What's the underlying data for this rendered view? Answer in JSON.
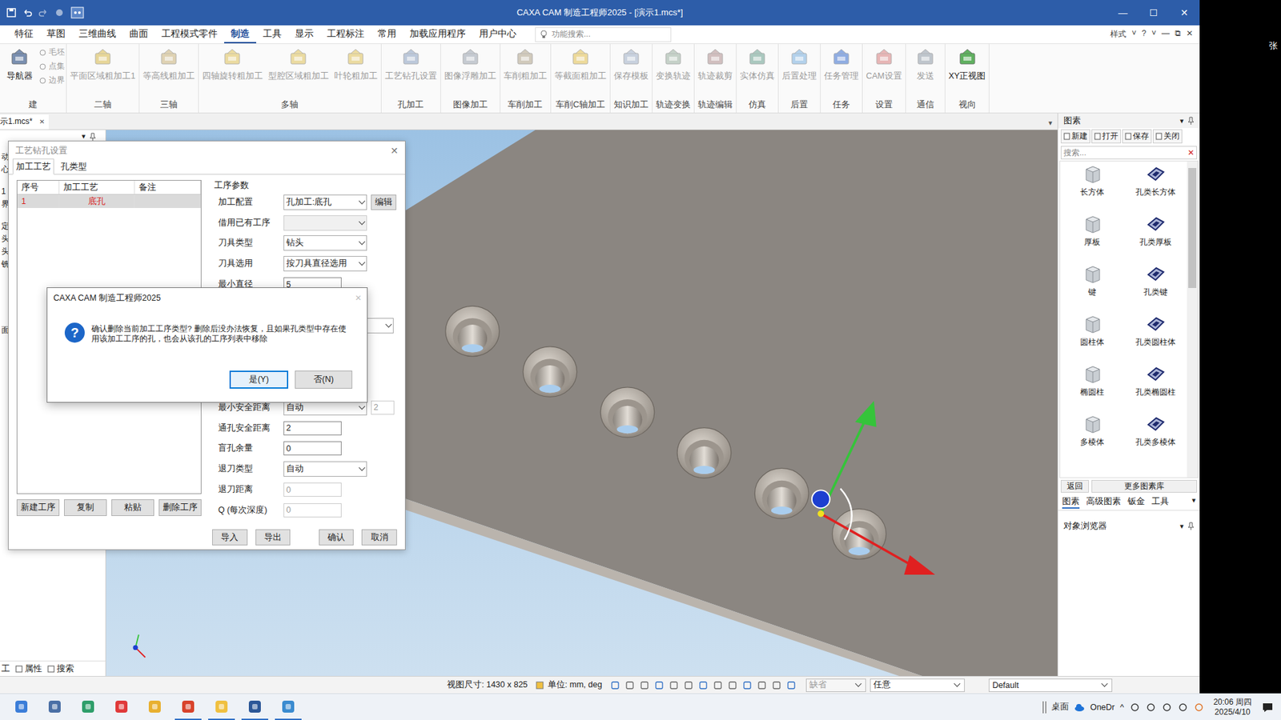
{
  "window": {
    "title": "CAXA CAM 制造工程师2025 - [演示1.mcs*]",
    "controls": [
      "—",
      "☐",
      "✕"
    ]
  },
  "outside_text": "张",
  "menu": {
    "items": [
      {
        "label": "特征",
        "selected": false
      },
      {
        "label": "草图",
        "selected": false
      },
      {
        "label": "三维曲线",
        "selected": false
      },
      {
        "label": "曲面",
        "selected": false
      },
      {
        "label": "工程模式零件",
        "selected": false
      },
      {
        "label": "制造",
        "selected": true
      },
      {
        "label": "工具",
        "selected": false
      },
      {
        "label": "显示",
        "selected": false
      },
      {
        "label": "工程标注",
        "selected": false
      },
      {
        "label": "常用",
        "selected": false
      },
      {
        "label": "加载应用程序",
        "selected": false
      },
      {
        "label": "用户中心",
        "selected": false
      }
    ],
    "search_placeholder": "功能搜索...",
    "right": [
      "样式",
      "˅",
      "?",
      "˅",
      "—",
      "⧉",
      "✕"
    ]
  },
  "ribbon": {
    "groups": [
      {
        "label": "建",
        "tools": [
          {
            "label": "导航器",
            "kind": "large",
            "disabled": false
          },
          {
            "label": "毛坯",
            "kind": "small",
            "disabled": true
          },
          {
            "label": "点集",
            "kind": "small",
            "disabled": true
          },
          {
            "label": "边界",
            "kind": "small",
            "disabled": true
          }
        ]
      },
      {
        "label": "二轴",
        "tools": [
          {
            "label": "平面区域粗加工1",
            "kind": "large",
            "disabled": true
          }
        ]
      },
      {
        "label": "三轴",
        "tools": [
          {
            "label": "等高线粗加工",
            "kind": "large",
            "disabled": true
          }
        ]
      },
      {
        "label": "多轴",
        "tools": [
          {
            "label": "四轴旋转粗加工",
            "kind": "large",
            "disabled": true
          },
          {
            "label": "型腔区域粗加工",
            "kind": "large",
            "disabled": true
          },
          {
            "label": "叶轮粗加工",
            "kind": "large",
            "disabled": true
          }
        ]
      },
      {
        "label": "孔加工",
        "tools": [
          {
            "label": "工艺钻孔设置",
            "kind": "large",
            "disabled": true
          }
        ]
      },
      {
        "label": "图像加工",
        "tools": [
          {
            "label": "图像浮雕加工",
            "kind": "large",
            "disabled": true
          }
        ]
      },
      {
        "label": "车削加工",
        "tools": [
          {
            "label": "车削粗加工",
            "kind": "large",
            "disabled": true
          }
        ]
      },
      {
        "label": "车削C轴加工",
        "tools": [
          {
            "label": "等截面粗加工",
            "kind": "large",
            "disabled": true
          }
        ]
      },
      {
        "label": "知识加工",
        "tools": [
          {
            "label": "保存模板",
            "kind": "large",
            "disabled": true
          }
        ]
      },
      {
        "label": "轨迹变换",
        "tools": [
          {
            "label": "变换轨迹",
            "kind": "large",
            "disabled": true
          }
        ]
      },
      {
        "label": "轨迹编辑",
        "tools": [
          {
            "label": "轨迹裁剪",
            "kind": "large",
            "disabled": true
          }
        ]
      },
      {
        "label": "仿真",
        "tools": [
          {
            "label": "实体仿真",
            "kind": "large",
            "disabled": true
          }
        ]
      },
      {
        "label": "后置",
        "tools": [
          {
            "label": "后置处理",
            "kind": "large",
            "disabled": true
          }
        ]
      },
      {
        "label": "任务",
        "tools": [
          {
            "label": "任务管理",
            "kind": "large",
            "disabled": true
          }
        ]
      },
      {
        "label": "设置",
        "tools": [
          {
            "label": "CAM设置",
            "kind": "large",
            "disabled": true
          }
        ]
      },
      {
        "label": "通信",
        "tools": [
          {
            "label": "发送",
            "kind": "large",
            "disabled": true
          }
        ]
      },
      {
        "label": "视向",
        "tools": [
          {
            "label": "XY正视图",
            "kind": "large",
            "disabled": false
          }
        ]
      }
    ]
  },
  "document_tabs": [
    {
      "label": "示1.mcs*",
      "selected": true,
      "close": "✕"
    }
  ],
  "tab_row_menu": "▾",
  "left_panel": {
    "menu": "▾",
    "groups": [
      [
        "动",
        "心"
      ],
      [
        "1",
        "界"
      ],
      [
        "定",
        "头",
        "头",
        "铣"
      ],
      [
        "面"
      ]
    ],
    "bottom_tabs": [
      "工",
      "属性",
      "搜索"
    ]
  },
  "dialog": {
    "title": "工艺钻孔设置",
    "close": "✕",
    "tabs": [
      {
        "label": "加工工艺",
        "selected": true
      },
      {
        "label": "孔类型",
        "selected": false
      }
    ],
    "table": {
      "columns": [
        "序号",
        "加工工艺",
        "备注"
      ],
      "rows": [
        {
          "cells": [
            "1",
            "底孔",
            ""
          ],
          "selected": true
        }
      ]
    },
    "list_buttons": [
      "新建工序",
      "复制",
      "粘贴",
      "删除工序"
    ],
    "section_title": "工序参数",
    "params": [
      {
        "label": "加工配置",
        "kind": "dropdown",
        "value": "孔加工:底孔",
        "disabled": false,
        "button": "编辑"
      },
      {
        "label": "借用已有工序",
        "kind": "dropdown",
        "value": "",
        "disabled": true
      },
      {
        "label": "刀具类型",
        "kind": "dropdown",
        "value": "钻头",
        "disabled": false
      },
      {
        "label": "刀具选用",
        "kind": "dropdown",
        "value": "按刀具直径选用",
        "disabled": false
      },
      {
        "label": "最小直径",
        "kind": "field",
        "value": "5",
        "disabled": false
      },
      {
        "label": "",
        "kind": "blank",
        "value": "",
        "disabled": false
      },
      {
        "label": "",
        "kind": "wide-dropdown",
        "value": "",
        "disabled": false
      },
      {
        "label": "",
        "kind": "dropdown",
        "value": "",
        "disabled": true
      },
      {
        "label": "",
        "kind": "blank",
        "value": "",
        "disabled": false
      },
      {
        "label": "",
        "kind": "blank",
        "value": "",
        "disabled": false
      },
      {
        "label": "最小安全距离",
        "kind": "dropdown-field",
        "value": "自动",
        "extra": "2",
        "disabled": false
      },
      {
        "label": "通孔安全距离",
        "kind": "field",
        "value": "2",
        "disabled": false
      },
      {
        "label": "盲孔余量",
        "kind": "field",
        "value": "0",
        "disabled": false
      },
      {
        "label": "退刀类型",
        "kind": "dropdown",
        "value": "自动",
        "disabled": false
      },
      {
        "label": "退刀距离",
        "kind": "field",
        "value": "0",
        "disabled": true
      },
      {
        "label": "Q (每次深度)",
        "kind": "field",
        "value": "0",
        "disabled": true
      }
    ],
    "footer_left": [
      "导入",
      "导出"
    ],
    "footer_right": [
      "确认",
      "取消"
    ]
  },
  "message_box": {
    "title": "CAXA CAM 制造工程师2025",
    "close": "✕",
    "icon": "?",
    "text": "确认删除当前加工工序类型? 删除后没办法恢复，且如果孔类型中存在使用该加工工序的孔，也会从该孔的工序列表中移除",
    "buttons": [
      {
        "label": "是(Y)",
        "selected": true
      },
      {
        "label": "否(N)",
        "selected": false
      }
    ]
  },
  "right_panel": {
    "title": "图素",
    "menu": "▾",
    "toolbar": [
      "新建",
      "打开",
      "保存",
      "关闭"
    ],
    "search_placeholder": "搜索...",
    "clear": "✕",
    "items": [
      {
        "label": "长方体",
        "kind": "solid"
      },
      {
        "label": "孔类长方体",
        "kind": "hole"
      },
      {
        "label": "厚板",
        "kind": "solid"
      },
      {
        "label": "孔类厚板",
        "kind": "hole"
      },
      {
        "label": "键",
        "kind": "solid"
      },
      {
        "label": "孔类键",
        "kind": "hole"
      },
      {
        "label": "圆柱体",
        "kind": "solid"
      },
      {
        "label": "孔类圆柱体",
        "kind": "hole"
      },
      {
        "label": "椭圆柱",
        "kind": "solid"
      },
      {
        "label": "孔类椭圆柱",
        "kind": "hole"
      },
      {
        "label": "多棱体",
        "kind": "solid"
      },
      {
        "label": "孔类多棱体",
        "kind": "hole"
      }
    ],
    "nav": [
      "返回",
      "更多图素库"
    ],
    "tabs": [
      {
        "label": "图素",
        "selected": true
      },
      {
        "label": "高级图素",
        "selected": false
      },
      {
        "label": "钣金",
        "selected": false
      },
      {
        "label": "工具",
        "selected": false
      }
    ],
    "tabs_menu": "▾",
    "object_browser": {
      "title": "对象浏览器",
      "menu": "▾"
    }
  },
  "status_bar": {
    "view_size": "视图尺寸: 1430 x 825",
    "units": "单位: mm, deg",
    "combos": [
      {
        "value": "缺省",
        "disabled": true
      },
      {
        "value": "任意",
        "disabled": false
      },
      {
        "value": "Default",
        "disabled": false
      }
    ]
  },
  "taskbar": {
    "apps": [
      {
        "running": false
      },
      {
        "running": false
      },
      {
        "running": false
      },
      {
        "running": false
      },
      {
        "running": false
      },
      {
        "running": true
      },
      {
        "running": true
      },
      {
        "running": true
      },
      {
        "running": true
      }
    ],
    "desktop": "桌面",
    "cloud": "OneDr",
    "chevron": "^",
    "time": "20:06 周四",
    "date": "2025/4/10"
  }
}
